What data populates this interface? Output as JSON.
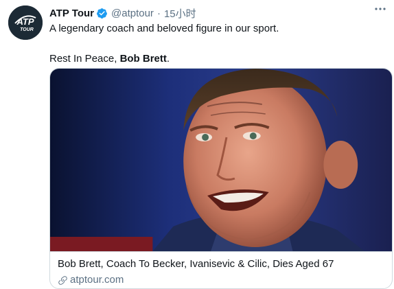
{
  "author": {
    "avatar_text": "ATP",
    "avatar_subtext": "TOUR",
    "display_name": "ATP Tour",
    "handle": "@atptour",
    "separator": "·",
    "timestamp": "15小时"
  },
  "tweet": {
    "line1": "A legendary coach and beloved figure in our sport.",
    "line2_prefix": "Rest In Peace, ",
    "line2_bold": "Bob Brett",
    "line2_suffix": "."
  },
  "card": {
    "title": "Bob Brett, Coach To Becker, Ivanisevic & Cilic, Dies Aged 67",
    "domain": "atptour.com",
    "icons": {
      "link": "link-icon"
    }
  },
  "icons": {
    "verified": "verified-badge-icon",
    "more": "more-options-icon"
  },
  "colors": {
    "accent": "#1d9bf0",
    "muted": "#5b7083",
    "avatar_bg": "#1c2a35"
  }
}
